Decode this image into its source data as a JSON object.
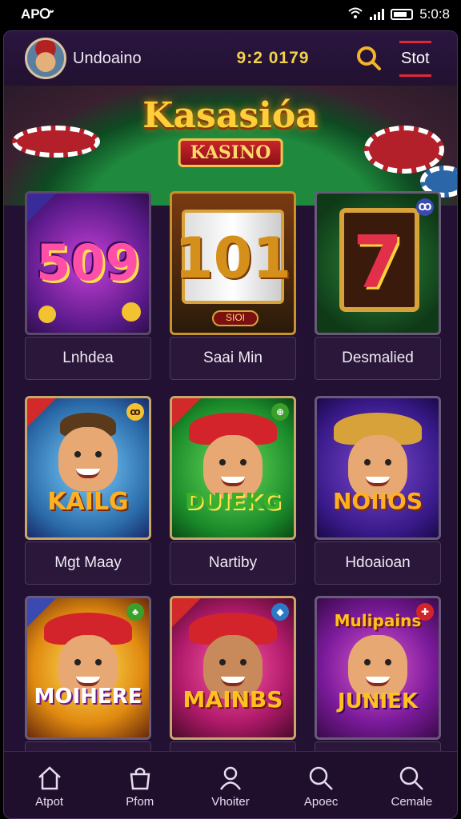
{
  "status": {
    "carrier": "APᏅ",
    "time": "5:0:8"
  },
  "header": {
    "username": "Undoaino",
    "balance": "9:2 0179",
    "tab_label": "Stot"
  },
  "banner": {
    "title": "Kasasióa",
    "subtitle": "KASINO"
  },
  "games": [
    {
      "label": "Lnhdea",
      "art_text": "509",
      "badge": ""
    },
    {
      "label": "Saai Min",
      "art_text": "101",
      "art_sub": "SIOI",
      "badge": ""
    },
    {
      "label": "Desmalied",
      "art_text": "7",
      "badge": "Ꝏ"
    },
    {
      "label": "Mgt Maay",
      "art_text": "KAILG",
      "badge": "ꝏ"
    },
    {
      "label": "Nartiby",
      "art_text": "DUIEKG",
      "badge": "⊕"
    },
    {
      "label": "Hdoaioan",
      "art_text": "NOIIOS",
      "badge": ""
    },
    {
      "label": "",
      "art_text": "MOIHERE",
      "badge": "♣"
    },
    {
      "label": "",
      "art_text": "MAINBS",
      "badge": "◆"
    },
    {
      "label": "",
      "art_text": "JUNIEK",
      "art_top": "Mulipains",
      "badge": "✚"
    }
  ],
  "nav": [
    {
      "label": "Atpot",
      "icon": "home-icon"
    },
    {
      "label": "Pfom",
      "icon": "bag-icon"
    },
    {
      "label": "Vhoiter",
      "icon": "person-icon"
    },
    {
      "label": "Apoec",
      "icon": "search-icon"
    },
    {
      "label": "Cemale",
      "icon": "search-icon"
    }
  ],
  "colors": {
    "background": "#231133",
    "balance": "#f2d34b",
    "accent_red": "#e02838",
    "gold": "#ffcf3a"
  }
}
